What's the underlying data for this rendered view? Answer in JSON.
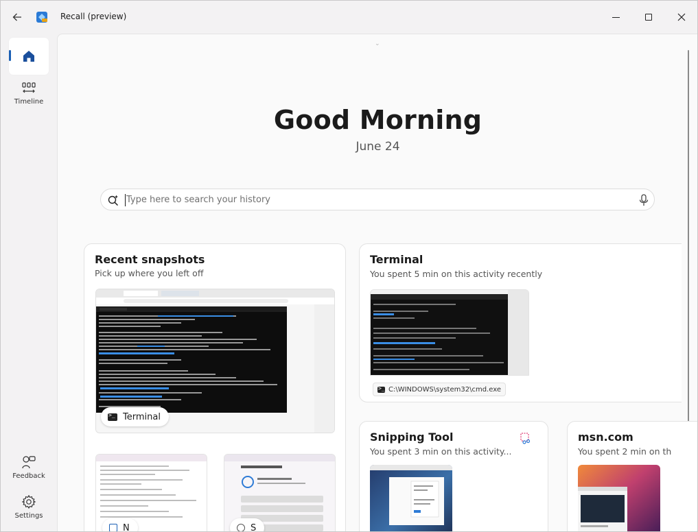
{
  "titlebar": {
    "title": "Recall (preview)",
    "back_icon": "back-arrow-icon",
    "minimize_icon": "minimize-icon",
    "maximize_icon": "maximize-icon",
    "close_icon": "close-icon"
  },
  "sidebar": {
    "items": [
      {
        "label": "",
        "icon": "home-icon",
        "selected": true
      },
      {
        "label": "Timeline",
        "icon": "timeline-icon"
      },
      {
        "label": "Feedback",
        "icon": "feedback-icon"
      },
      {
        "label": "Settings",
        "icon": "gear-icon"
      }
    ]
  },
  "home": {
    "greeting": "Good Morning",
    "date": "June 24"
  },
  "search": {
    "placeholder": "Type here to search your history",
    "value": ""
  },
  "cards": {
    "recent": {
      "title": "Recent snapshots",
      "subtitle": "Pick up where you left off",
      "main_badge": "Terminal",
      "bottom_badges": [
        "N",
        "S"
      ]
    },
    "terminal": {
      "title": "Terminal",
      "subtitle": "You spent 5 min on this activity recently",
      "path": "C:\\WINDOWS\\system32\\cmd.exe"
    },
    "snipping": {
      "title": "Snipping Tool",
      "subtitle": "You spent 3 min on this activity..."
    },
    "msn": {
      "title": "msn.com",
      "subtitle": "You spent 2 min on th"
    }
  },
  "colors": {
    "accent": "#1a5fb4",
    "background": "#f3f2f3",
    "panel": "#fafafa"
  }
}
